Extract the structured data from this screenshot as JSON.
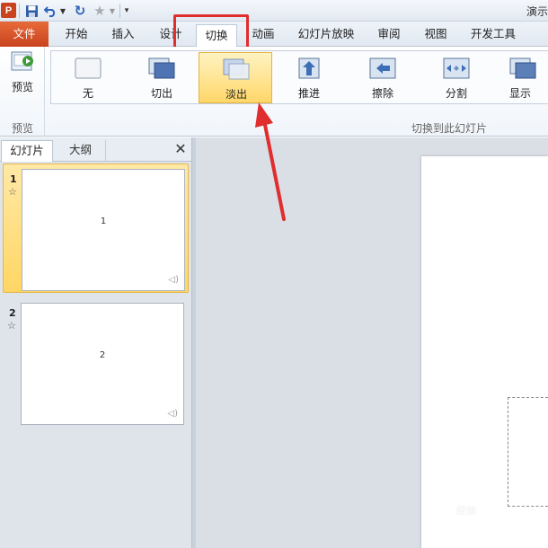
{
  "app": {
    "title": "演示",
    "icon_letter": "P"
  },
  "tabs": {
    "file": "文件",
    "home": "开始",
    "insert": "插入",
    "design": "设计",
    "transitions": "切换",
    "animations": "动画",
    "slideshow": "幻灯片放映",
    "review": "审阅",
    "view": "视图",
    "developer": "开发工具"
  },
  "ribbon": {
    "preview_button": "预览",
    "preview_group": "预览",
    "transition_group": "切换到此幻灯片",
    "effects": [
      {
        "label": "无",
        "icon": "none-effect-icon"
      },
      {
        "label": "切出",
        "icon": "cut-effect-icon"
      },
      {
        "label": "淡出",
        "icon": "fade-effect-icon",
        "selected": true
      },
      {
        "label": "推进",
        "icon": "push-effect-icon"
      },
      {
        "label": "擦除",
        "icon": "wipe-effect-icon"
      },
      {
        "label": "分割",
        "icon": "split-effect-icon"
      },
      {
        "label": "显示",
        "icon": "reveal-effect-icon"
      }
    ]
  },
  "pane": {
    "tab_slides": "幻灯片",
    "tab_outline": "大纲",
    "close_symbol": "✕"
  },
  "slides": [
    {
      "number": "1",
      "content": "1",
      "selected": true
    },
    {
      "number": "2",
      "content": "2",
      "selected": false
    }
  ],
  "watermark": "经验",
  "colors": {
    "file_tab": "#c8431e",
    "selected_effect": "#ffd769",
    "annotation": "#e02d2d"
  }
}
